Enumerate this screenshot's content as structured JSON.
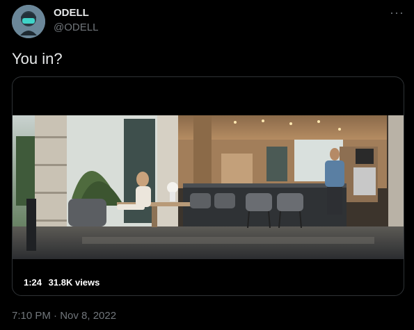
{
  "author": {
    "display_name": "ODELL",
    "handle": "@ODELL",
    "avatar_icon": "masked-avatar-icon"
  },
  "tweet": {
    "text": "You in?",
    "timestamp": "7:10 PM · Nov 8, 2022"
  },
  "media": {
    "duration": "1:24",
    "views": "31.8K views"
  },
  "colors": {
    "background": "#000000",
    "text_primary": "#e7e9ea",
    "text_secondary": "#71767b",
    "border": "#2f3336"
  }
}
